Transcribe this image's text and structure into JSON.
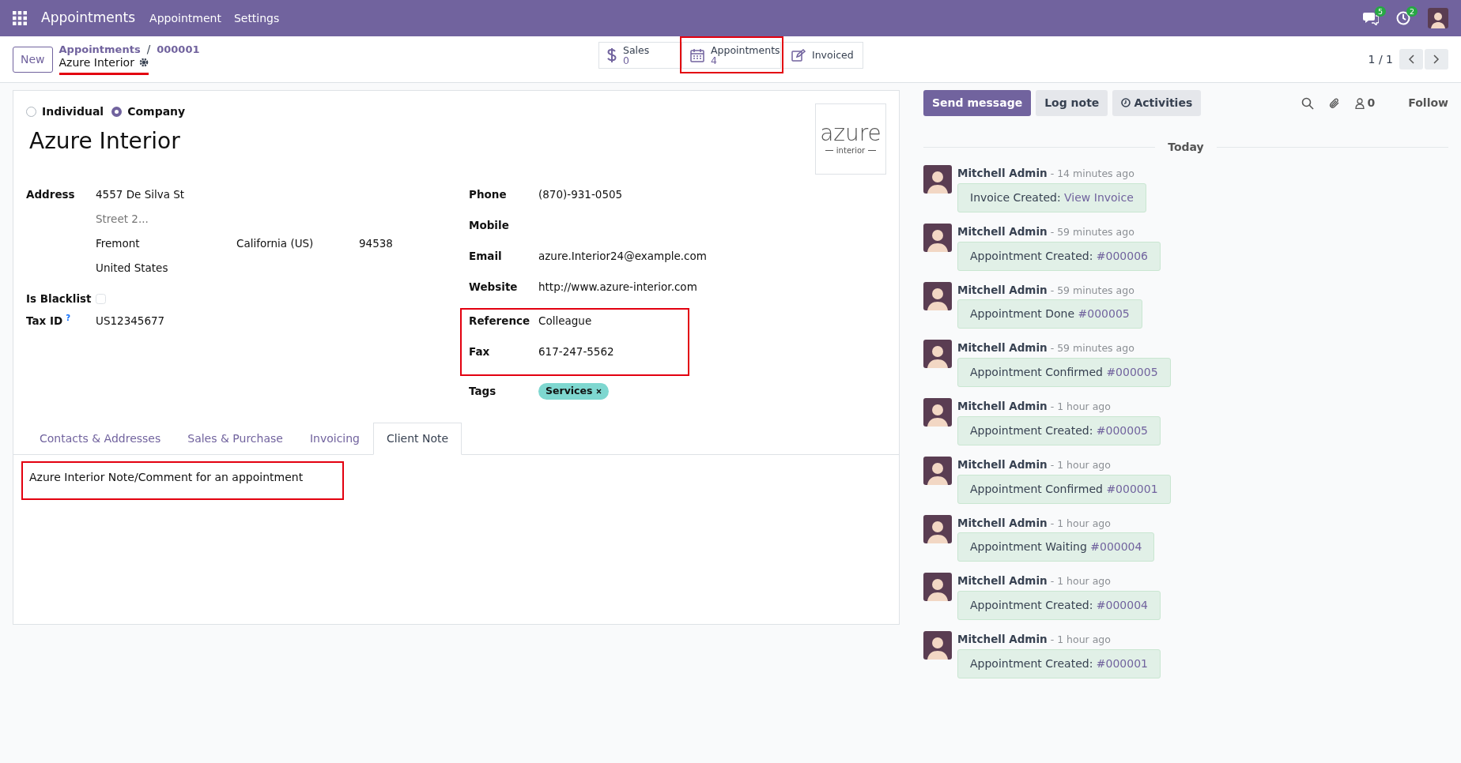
{
  "navbar": {
    "app_name": "Appointments",
    "menus": [
      "Appointment",
      "Settings"
    ],
    "messages_count": "5",
    "activities_count": "2"
  },
  "control_panel": {
    "new_button": "New",
    "breadcrumbs": [
      "Appointments",
      "000001"
    ],
    "breadcrumb_separator": "/",
    "record_name": "Azure Interior",
    "record_name_highlighted": true,
    "smart_buttons": [
      {
        "kind": "stat",
        "label": "Sales",
        "value": "0",
        "highlighted": false
      },
      {
        "kind": "stat",
        "label": "Appointments",
        "value": "4",
        "highlighted": true
      },
      {
        "kind": "plain",
        "label": "Invoiced",
        "highlighted": false
      }
    ],
    "pager": "1 / 1"
  },
  "form": {
    "company_types": [
      {
        "label": "Individual",
        "selected": false
      },
      {
        "label": "Company",
        "selected": true
      }
    ],
    "name": "Azure Interior",
    "logo": {
      "word": "azure",
      "sub": "interior"
    },
    "address": {
      "label": "Address",
      "street": "4557 De Silva St",
      "street2_placeholder": "Street 2...",
      "city": "Fremont",
      "state": "California (US)",
      "zip": "94538",
      "country": "United States"
    },
    "blacklist": {
      "label": "Is Blacklist",
      "checked": false
    },
    "tax_id": {
      "label": "Tax ID",
      "help": "?",
      "value": "US12345677"
    },
    "right_fields": [
      {
        "label": "Phone",
        "value": "(870)-931-0505",
        "highlighted": false
      },
      {
        "label": "Mobile",
        "highlighted": false
      },
      {
        "label": "Email",
        "value": "azure.Interior24@example.com",
        "highlighted": false
      },
      {
        "label": "Website",
        "value": "http://www.azure-interior.com",
        "highlighted": false
      },
      {
        "label": "Reference",
        "value": "Colleague",
        "highlighted": true
      },
      {
        "label": "Fax",
        "value": "617-247-5562",
        "highlighted": true
      }
    ],
    "tags": {
      "label": "Tags",
      "items": [
        {
          "label": "Services",
          "color": "#7ed7d0"
        }
      ]
    },
    "tabs": [
      {
        "label": "Contacts & Addresses",
        "selected": false
      },
      {
        "label": "Sales & Purchase",
        "selected": false
      },
      {
        "label": "Invoicing",
        "selected": false
      },
      {
        "label": "Client Note",
        "selected": true
      }
    ],
    "note": {
      "text": "Azure Interior Note/Comment for an appointment",
      "highlighted": true
    }
  },
  "chatter": {
    "buttons": [
      {
        "label": "Send message",
        "kind": "primary"
      },
      {
        "label": "Log note",
        "kind": "secondary"
      },
      {
        "label": "Activities",
        "kind": "activities"
      }
    ],
    "followers_count": "0",
    "follow": "Follow",
    "date_separator": "Today",
    "messages": [
      {
        "author": "Mitchell Admin",
        "time": "- 14 minutes ago",
        "text": "Invoice Created: ",
        "link": "View Invoice"
      },
      {
        "author": "Mitchell Admin",
        "time": "- 59 minutes ago",
        "text": "Appointment Created: ",
        "link": "#000006"
      },
      {
        "author": "Mitchell Admin",
        "time": "- 59 minutes ago",
        "text": "Appointment Done ",
        "link": "#000005"
      },
      {
        "author": "Mitchell Admin",
        "time": "- 59 minutes ago",
        "text": "Appointment Confirmed ",
        "link": "#000005"
      },
      {
        "author": "Mitchell Admin",
        "time": "- 1 hour ago",
        "text": "Appointment Created: ",
        "link": "#000005"
      },
      {
        "author": "Mitchell Admin",
        "time": "- 1 hour ago",
        "text": "Appointment Confirmed ",
        "link": "#000001"
      },
      {
        "author": "Mitchell Admin",
        "time": "- 1 hour ago",
        "text": "Appointment Waiting ",
        "link": "#000004"
      },
      {
        "author": "Mitchell Admin",
        "time": "- 1 hour ago",
        "text": "Appointment Created: ",
        "link": "#000004"
      },
      {
        "author": "Mitchell Admin",
        "time": "- 1 hour ago",
        "text": "Appointment Created: ",
        "link": "#000001"
      }
    ]
  }
}
